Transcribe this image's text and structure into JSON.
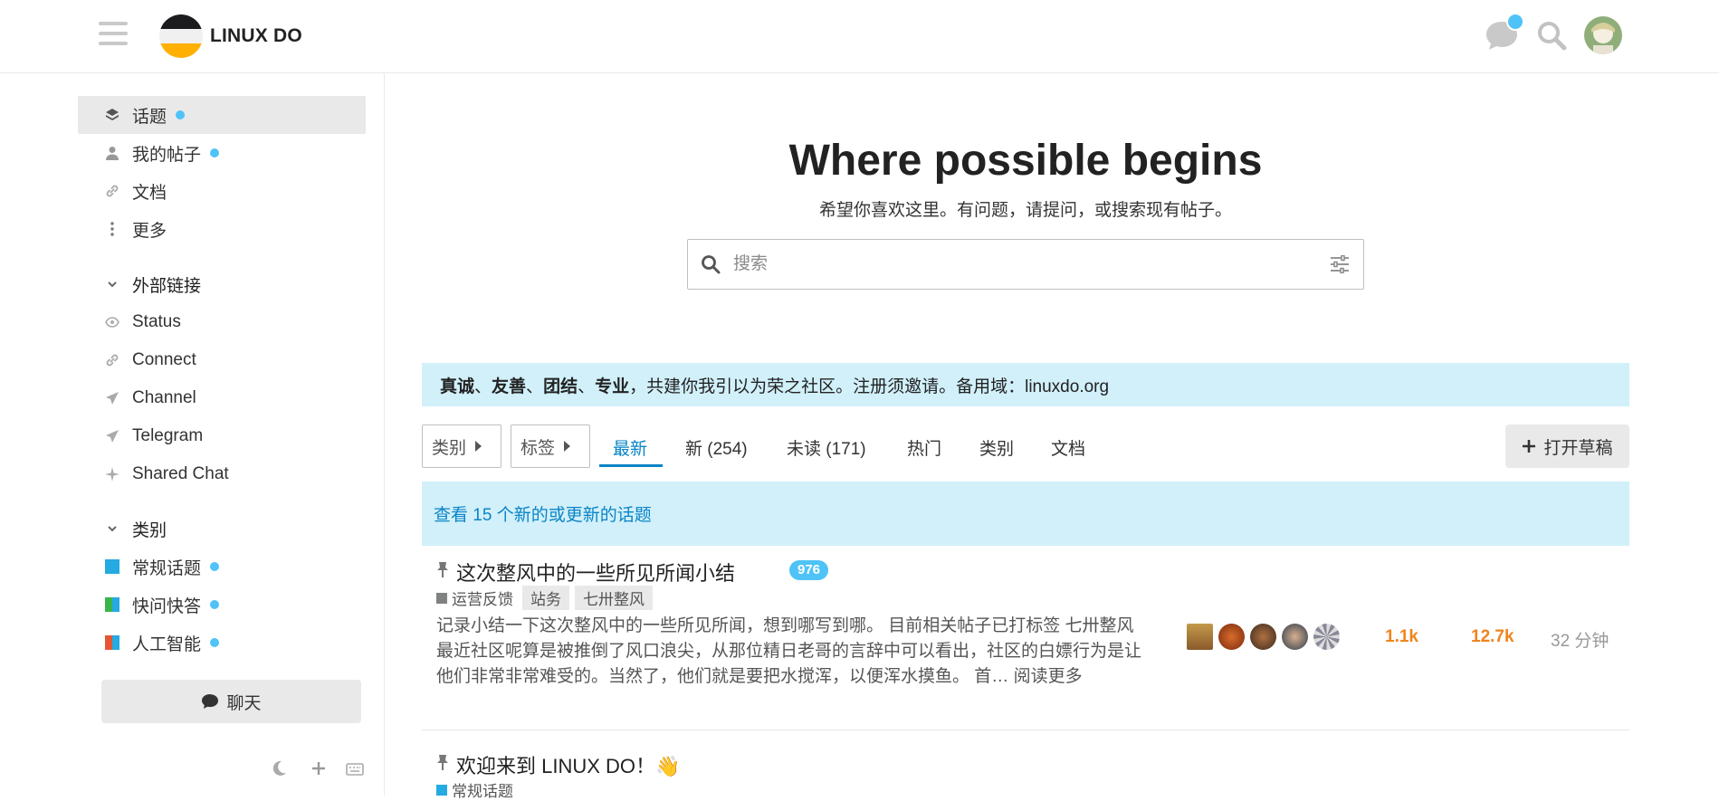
{
  "header": {
    "site_title": "LINUX DO",
    "icons": [
      "hamburger-icon",
      "chat-icon",
      "search-icon",
      "user-avatar"
    ]
  },
  "sidebar": {
    "nav": [
      {
        "label": "话题",
        "icon": "layers-icon",
        "dot": true,
        "active": true
      },
      {
        "label": "我的帖子",
        "icon": "user-icon",
        "dot": true
      },
      {
        "label": "文档",
        "icon": "link-icon"
      },
      {
        "label": "更多",
        "icon": "more-vertical-icon"
      }
    ],
    "external_section": "外部链接",
    "external": [
      {
        "label": "Status",
        "icon": "eye-icon"
      },
      {
        "label": "Connect",
        "icon": "link-icon"
      },
      {
        "label": "Channel",
        "icon": "paper-plane-icon"
      },
      {
        "label": "Telegram",
        "icon": "paper-plane-icon"
      },
      {
        "label": "Shared Chat",
        "icon": "sparkle-icon"
      }
    ],
    "categories_section": "类别",
    "categories": [
      {
        "label": "常规话题",
        "color": "#25aae2"
      },
      {
        "label": "快问快答",
        "color": "#3ab54a",
        "color2": "#25aae2"
      },
      {
        "label": "人工智能",
        "color": "#e45735",
        "color2": "#25aae2"
      }
    ],
    "chat_button": "聊天"
  },
  "hero": {
    "title": "Where possible begins",
    "subtitle": "希望你喜欢这里。有问题，请提问，或搜索现有帖子。",
    "search_placeholder": "搜索"
  },
  "banner": {
    "b1": "真诚",
    "s1": "、",
    "b2": "友善",
    "s2": "、",
    "b3": "团结",
    "s3": "、",
    "b4": "专业",
    "rest": "，共建你我引以为荣之社区。注册须邀请。备用域：linuxdo.org"
  },
  "navbar": {
    "category_dropdown": "类别",
    "tag_dropdown": "标签",
    "tabs": [
      "最新",
      "新 (254)",
      "未读 (171)",
      "热门",
      "类别",
      "文档"
    ],
    "draft_button": "打开草稿"
  },
  "new_topics_notice": "查看 15 个新的或更新的话题",
  "topics": [
    {
      "title": "这次整风中的一些所见所闻小结",
      "badge": "976",
      "category": "运营反馈",
      "category_color": "#808281",
      "tags": [
        "站务",
        "七卅整风"
      ],
      "excerpt": "记录小结一下这次整风中的一些所见所闻，想到哪写到哪。 目前相关帖子已打标签 七卅整风 最近社区呢算是被推倒了风口浪尖，从那位精日老哥的言辞中可以看出，社区的白嫖行为是让他们非常非常难受的。当然了，他们就是要把水搅浑，以便浑水摸鱼。 首…",
      "read_more": "阅读更多",
      "replies": "1.1k",
      "views": "12.7k",
      "activity": "32 分钟"
    },
    {
      "title": "欢迎来到 LINUX DO！👋",
      "category": "常规话题",
      "category_color": "#25aae2"
    }
  ]
}
